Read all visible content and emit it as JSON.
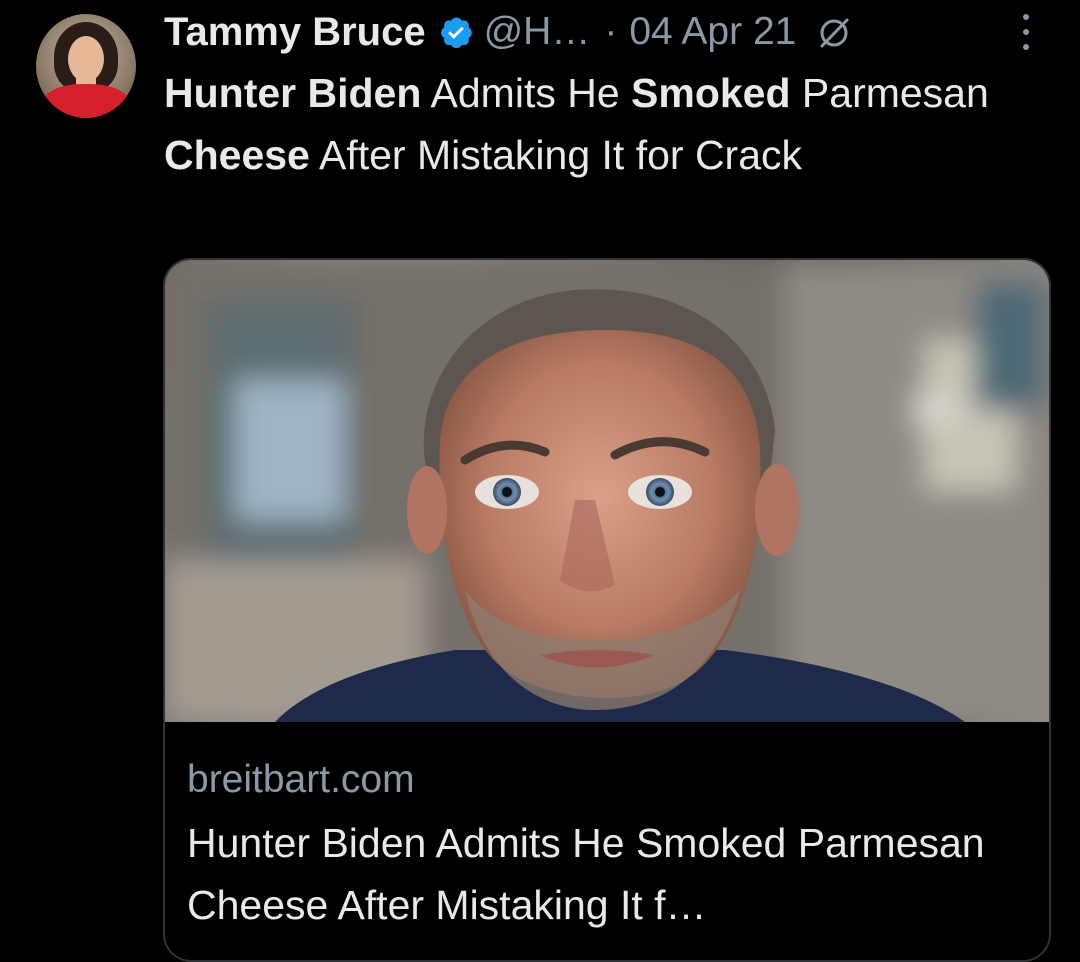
{
  "tweet": {
    "author_name": "Tammy Bruce",
    "handle": "@H…",
    "separator": "·",
    "date": "04 Apr 21",
    "text_segments": [
      {
        "text": "Hunter Biden",
        "bold": true
      },
      {
        "text": " Admits He ",
        "bold": false
      },
      {
        "text": "Smoked",
        "bold": true
      },
      {
        "text": " Parmesan ",
        "bold": false
      },
      {
        "text": "Cheese",
        "bold": true
      },
      {
        "text": " After Mistaking It for Crack",
        "bold": false
      }
    ]
  },
  "card": {
    "domain": "breitbart.com",
    "title": "Hunter Biden Admits He Smoked Parmesan Cheese After Mistaking It f…"
  },
  "icons": {
    "verified": "verified-badge-icon",
    "no_link": "slashed-circle-icon",
    "more": "more-vertical-icon"
  },
  "colors": {
    "background": "#000000",
    "text": "#e7e9ea",
    "secondary": "#8b98a5",
    "verified": "#1d9bf0",
    "card_border": "#2f3336"
  }
}
